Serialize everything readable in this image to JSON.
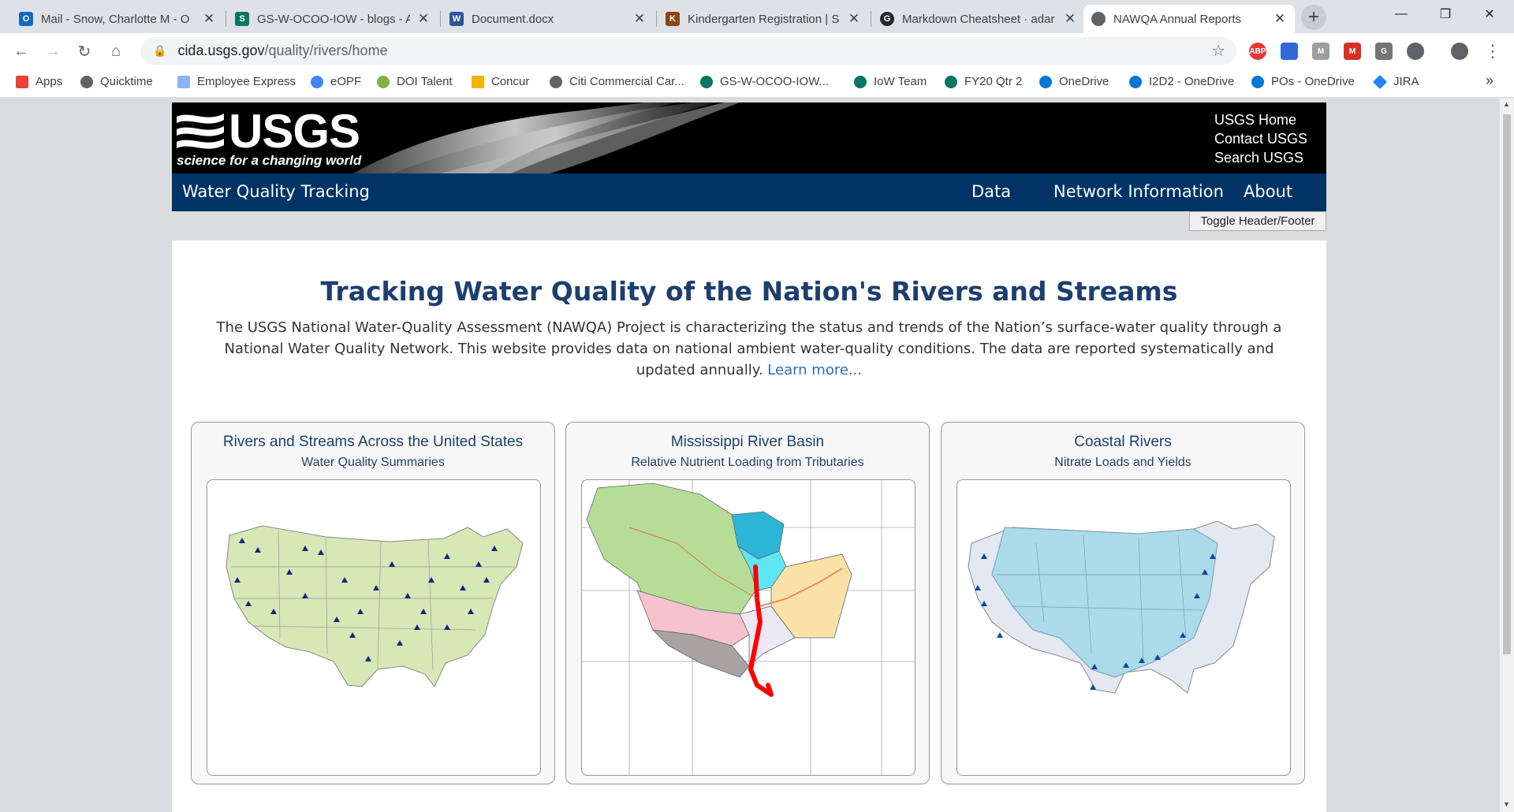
{
  "browser": {
    "tabs": [
      {
        "title": "Mail - Snow, Charlotte M - O",
        "favicon": "outlook-icon",
        "color": "#0f6cbd",
        "glyph": "O"
      },
      {
        "title": "GS-W-OCOO-IOW - blogs - A",
        "favicon": "sharepoint-icon",
        "color": "#077568",
        "glyph": "S"
      },
      {
        "title": "Document.docx",
        "favicon": "word-icon",
        "color": "#2b579a",
        "glyph": "W"
      },
      {
        "title": "Kindergarten Registration | S",
        "favicon": "school-icon",
        "color": "#8b4513",
        "glyph": "K"
      },
      {
        "title": "Markdown Cheatsheet · adar",
        "favicon": "github-icon",
        "color": "#24292e",
        "glyph": "G"
      },
      {
        "title": "NAWQA Annual Reports",
        "favicon": "globe-icon",
        "color": "#5f6368",
        "glyph": ""
      }
    ],
    "url_host": "cida.usgs.gov",
    "url_path": "/quality/rivers/home",
    "bookmarks": [
      {
        "label": "Apps",
        "color": "#ea4335"
      },
      {
        "label": "Quicktime",
        "color": "#5f6368"
      },
      {
        "label": "Employee Express",
        "color": "#8ab4f8"
      },
      {
        "label": "eOPF",
        "color": "#4285f4"
      },
      {
        "label": "DOI Talent",
        "color": "#7cb342"
      },
      {
        "label": "Concur",
        "color": "#f4b400"
      },
      {
        "label": "Citi Commercial Car...",
        "color": "#5f6368"
      },
      {
        "label": "GS-W-OCOO-IOW...",
        "color": "#077568"
      },
      {
        "label": "IoW Team",
        "color": "#077568"
      },
      {
        "label": "FY20 Qtr 2",
        "color": "#077568"
      },
      {
        "label": "OneDrive",
        "color": "#0078d4"
      },
      {
        "label": "I2D2 - OneDrive",
        "color": "#0078d4"
      },
      {
        "label": "POs - OneDrive",
        "color": "#0078d4"
      },
      {
        "label": "JIRA",
        "color": "#2684ff"
      }
    ],
    "bookmarks_overflow": "»"
  },
  "usgs": {
    "wordmark": "USGS",
    "tagline": "science for a changing world",
    "links": [
      "USGS Home",
      "Contact USGS",
      "Search USGS"
    ]
  },
  "site_nav": {
    "site_name": "Water Quality Tracking",
    "links": [
      "Data",
      "Network Information",
      "About"
    ]
  },
  "toggle_label": "Toggle Header/Footer",
  "main": {
    "title": "Tracking Water Quality of the Nation's Rivers and Streams",
    "intro": "The USGS National Water-Quality Assessment (NAWQA) Project is characterizing the status and trends of the Nation’s surface-water quality through a National Water Quality Network. This website provides data on national ambient water-quality conditions. The data are reported systematically and updated annually.",
    "learn_more": "Learn more...",
    "cards": [
      {
        "title": "Rivers and Streams Across the United States",
        "subtitle": "Water Quality Summaries"
      },
      {
        "title": "Mississippi River Basin",
        "subtitle": "Relative Nutrient Loading from Tributaries"
      },
      {
        "title": "Coastal Rivers",
        "subtitle": "Nitrate Loads and Yields"
      }
    ]
  }
}
